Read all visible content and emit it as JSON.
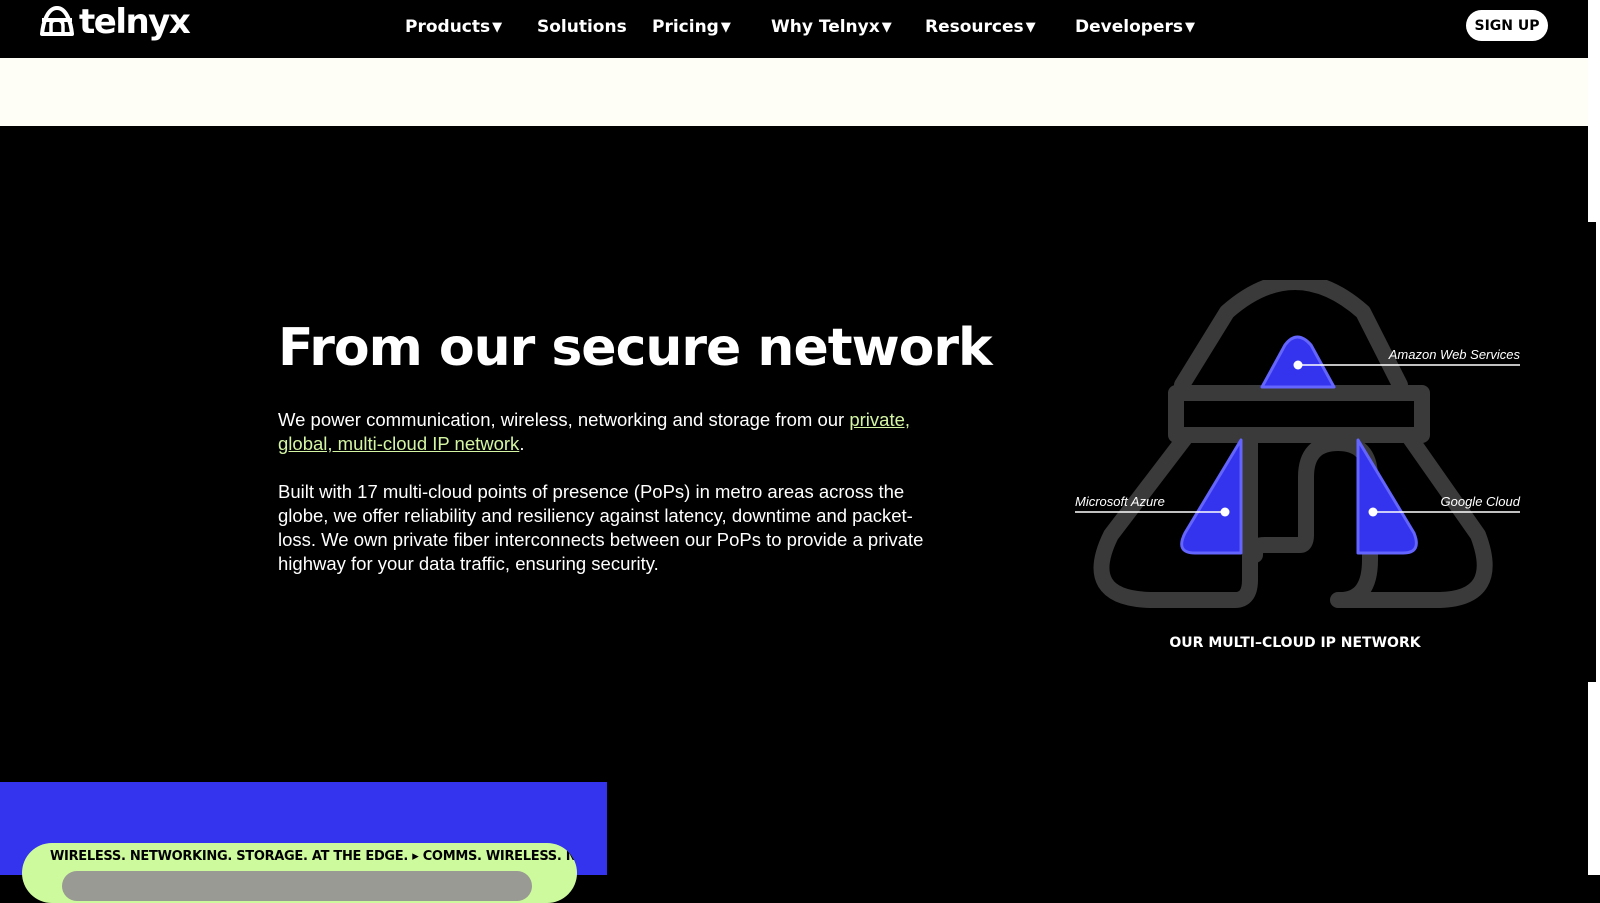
{
  "nav": {
    "logo_text": "telnyx",
    "items": [
      {
        "label": "Products",
        "dropdown": true
      },
      {
        "label": "Solutions",
        "dropdown": false
      },
      {
        "label": "Pricing",
        "dropdown": true
      },
      {
        "label": "Why Telnyx",
        "dropdown": true
      },
      {
        "label": "Resources",
        "dropdown": true
      },
      {
        "label": "Developers",
        "dropdown": true
      }
    ],
    "caret": "▼",
    "signup_label": "SIGN UP"
  },
  "section": {
    "headline": "From our secure network",
    "para1_text": "We power communication, wireless, networking and storage from our ",
    "para1_link": "private, global, multi-cloud IP network",
    "para1_end": ".",
    "para2": "Built with 17 multi-cloud points of presence (PoPs) in metro areas across the globe, we offer reliability and resiliency against latency, downtime and packet-loss. We own private fiber interconnects between our PoPs to provide a private highway for your data traffic, ensuring security."
  },
  "diagram": {
    "labels": {
      "aws": "Amazon Web Services",
      "azure": "Microsoft Azure",
      "gcp": "Google Cloud"
    },
    "caption": "OUR MULTI–CLOUD IP NETWORK",
    "colors": {
      "outline": "#3a3a3a",
      "fill": "#3434ef",
      "fill_border": "#6464ff"
    }
  },
  "ticker": {
    "text": "WIRELESS. NETWORKING. STORAGE. AT THE EDGE. ▸ COMMS. WIRELESS. NETWORKING."
  },
  "colors": {
    "link": "#d4f5a3",
    "blue": "#3434ef",
    "pill": "#cdfa9d",
    "cream": "#fefef6"
  }
}
